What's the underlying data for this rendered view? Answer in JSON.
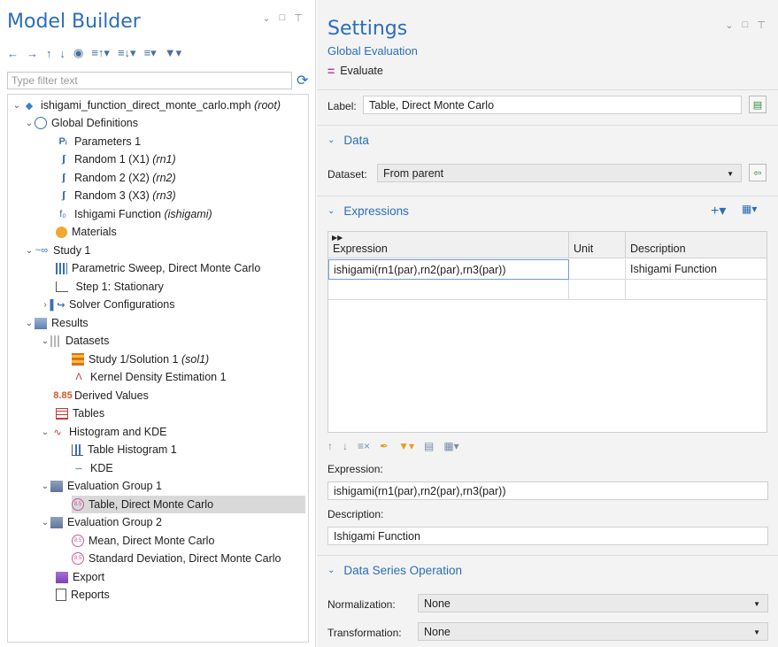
{
  "model_builder": {
    "title": "Model Builder",
    "filter_placeholder": "Type filter text",
    "tree": [
      {
        "label": "ishigami_function_direct_monte_carlo.mph",
        "suffix": "(root)"
      },
      {
        "label": "Global Definitions"
      },
      {
        "label": "Parameters 1"
      },
      {
        "label": "Random 1 (X1)",
        "suffix": "(rn1)"
      },
      {
        "label": "Random 2 (X2)",
        "suffix": "(rn2)"
      },
      {
        "label": "Random 3 (X3)",
        "suffix": "(rn3)"
      },
      {
        "label": "Ishigami Function",
        "suffix": "(ishigami)"
      },
      {
        "label": "Materials"
      },
      {
        "label": "Study 1"
      },
      {
        "label": "Parametric Sweep, Direct Monte Carlo"
      },
      {
        "label": "Step 1: Stationary"
      },
      {
        "label": "Solver Configurations"
      },
      {
        "label": "Results"
      },
      {
        "label": "Datasets"
      },
      {
        "label": "Study 1/Solution 1",
        "suffix": "(sol1)"
      },
      {
        "label": "Kernel Density Estimation 1"
      },
      {
        "label": "Derived Values"
      },
      {
        "label": "Tables"
      },
      {
        "label": "Histogram and KDE"
      },
      {
        "label": "Table Histogram 1"
      },
      {
        "label": "KDE"
      },
      {
        "label": "Evaluation Group 1"
      },
      {
        "label": "Table, Direct Monte Carlo"
      },
      {
        "label": "Evaluation Group 2"
      },
      {
        "label": "Mean, Direct Monte Carlo"
      },
      {
        "label": "Standard Deviation, Direct Monte Carlo"
      },
      {
        "label": "Export"
      },
      {
        "label": "Reports"
      }
    ],
    "selected_node": "Table, Direct Monte Carlo"
  },
  "settings": {
    "title": "Settings",
    "subtitle": "Global Evaluation",
    "evaluate_label": "Evaluate",
    "label_field": {
      "caption": "Label:",
      "value": "Table, Direct Monte Carlo"
    },
    "data_section": {
      "title": "Data",
      "dataset_caption": "Dataset:",
      "dataset_value": "From parent"
    },
    "expressions_section": {
      "title": "Expressions",
      "columns": [
        "Expression",
        "Unit",
        "Description"
      ],
      "rows": [
        {
          "expression": "ishigami(rn1(par),rn2(par),rn3(par))",
          "unit": "",
          "description": "Ishigami Function"
        },
        {
          "expression": "",
          "unit": "",
          "description": ""
        }
      ],
      "expression_caption": "Expression:",
      "expression_value": "ishigami(rn1(par),rn2(par),rn3(par))",
      "description_caption": "Description:",
      "description_value": "Ishigami Function"
    },
    "data_series_section": {
      "title": "Data Series Operation",
      "normalization_caption": "Normalization:",
      "normalization_value": "None",
      "transformation_caption": "Transformation:",
      "transformation_value": "None"
    }
  },
  "colors": {
    "accent_blue": "#2a6ebb",
    "selection": "#d9d9d9",
    "panel_bg": "#f3f3f3"
  }
}
